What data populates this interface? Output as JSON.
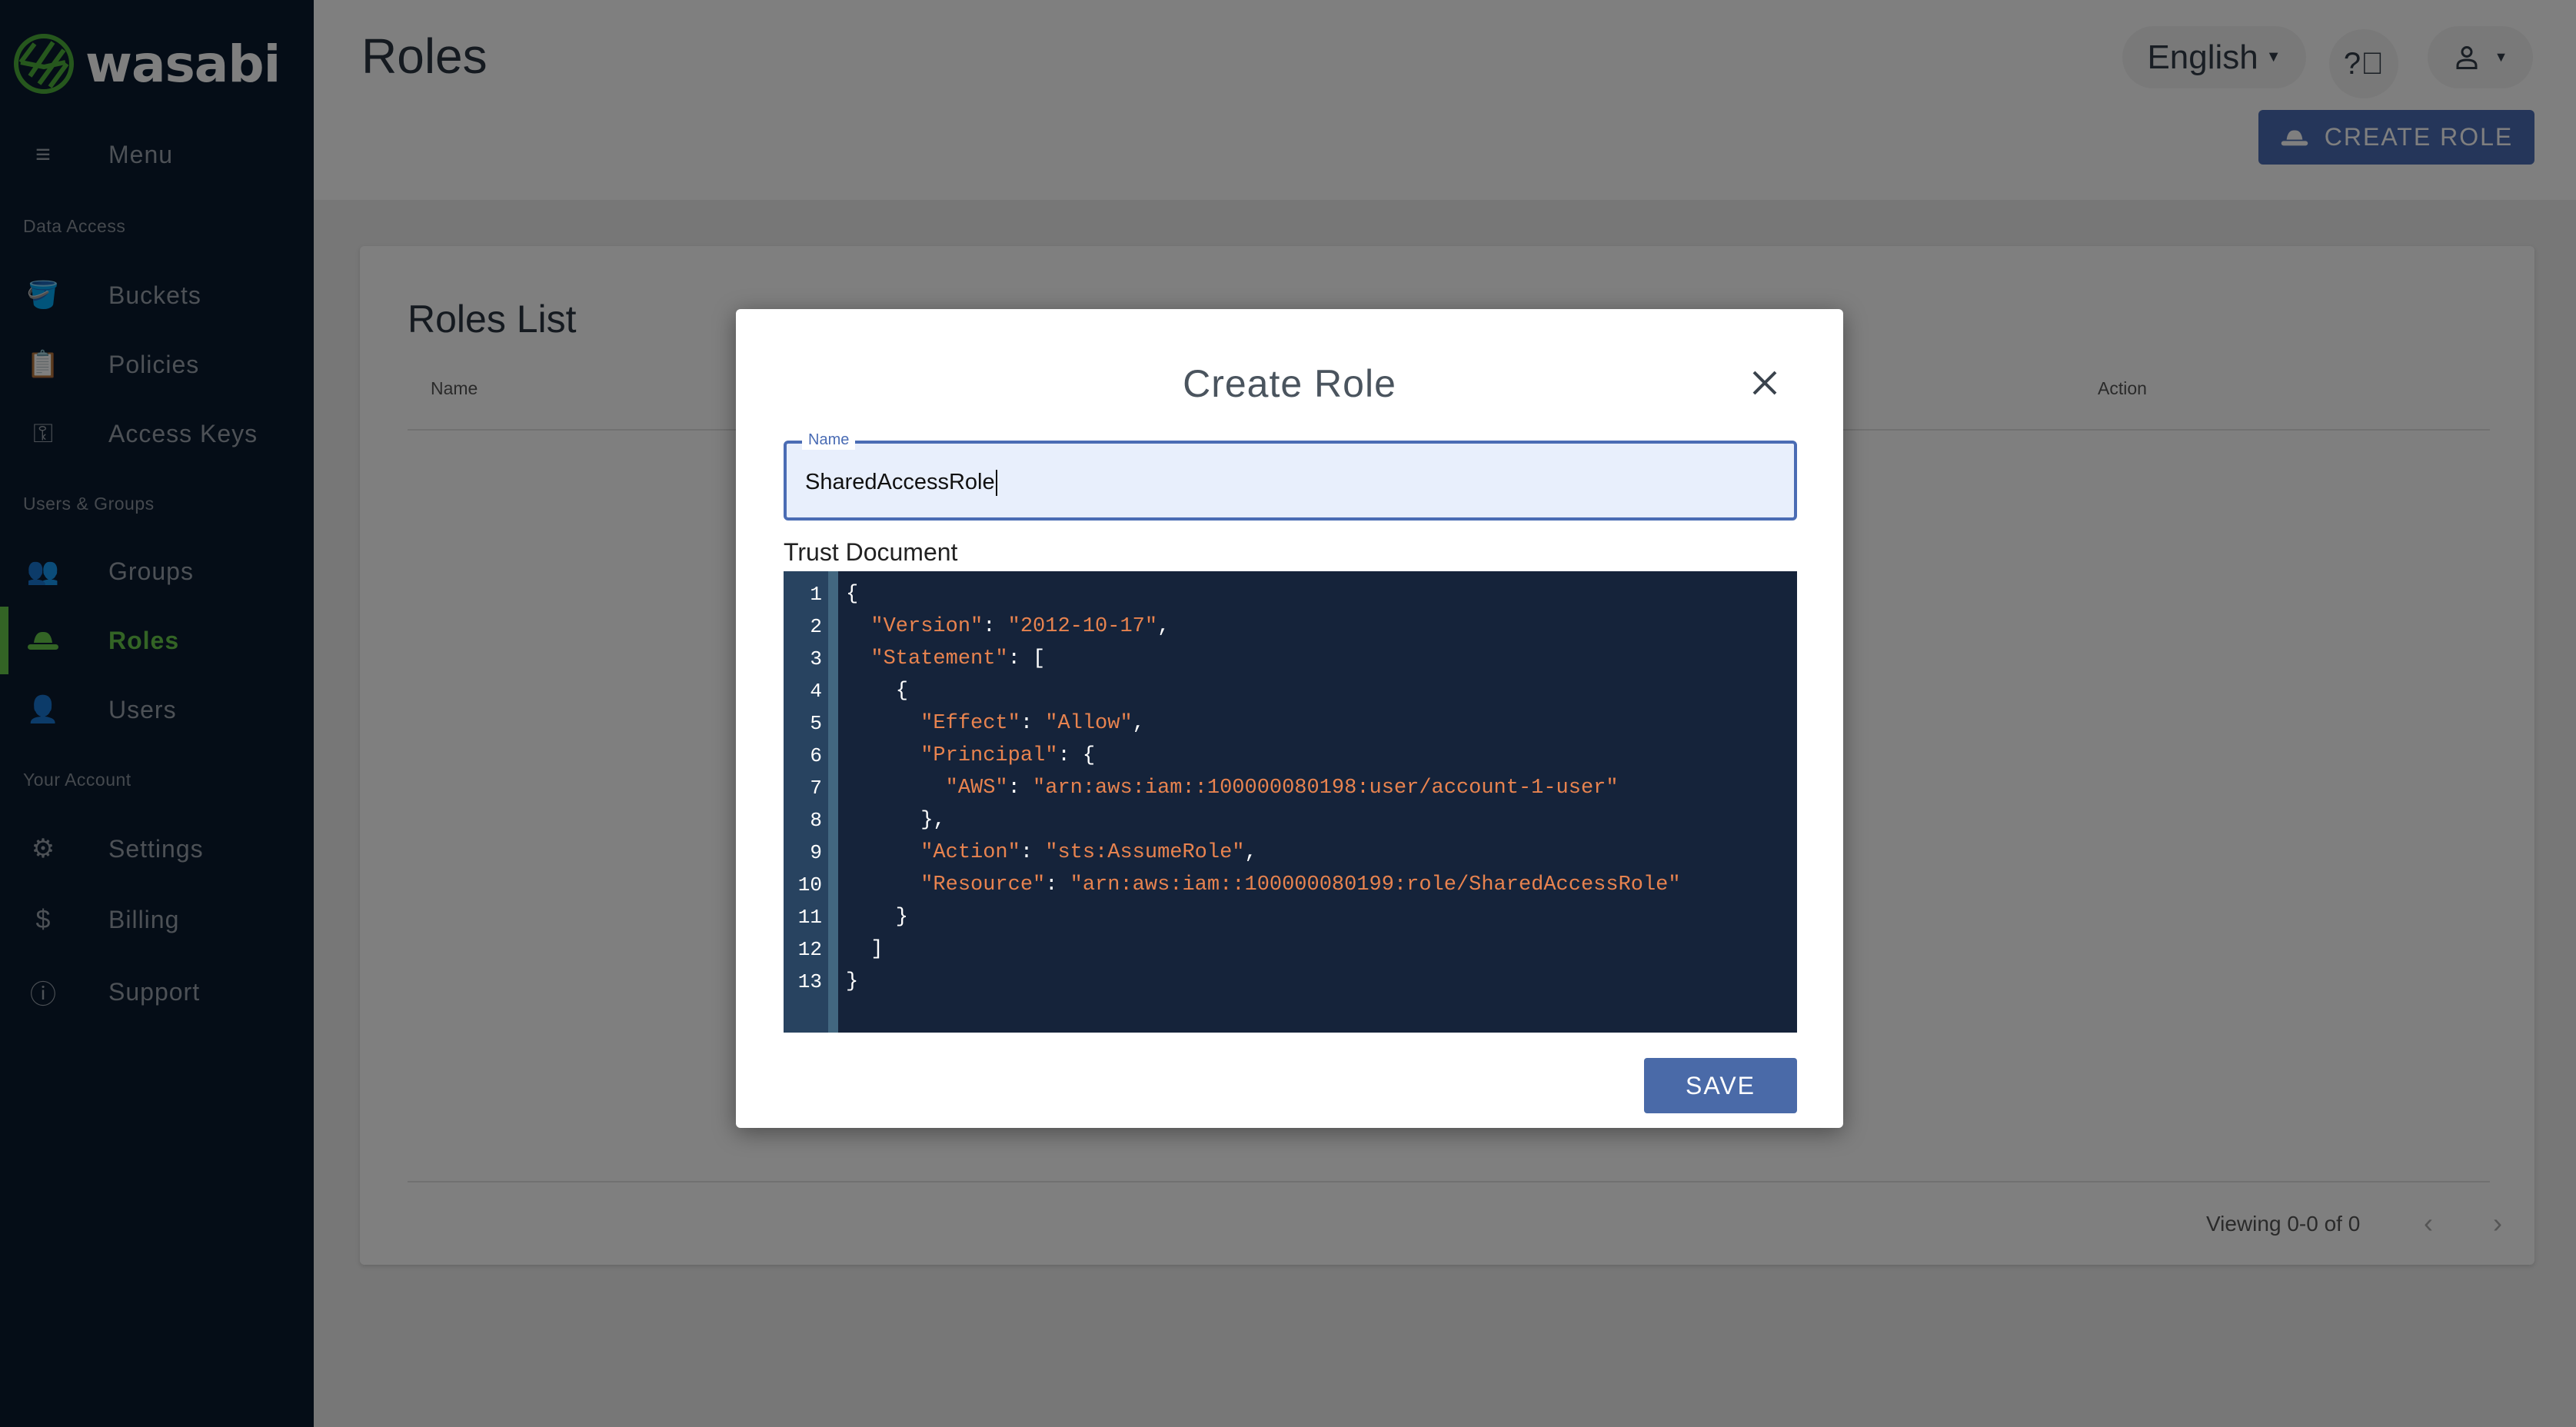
{
  "brand": {
    "name": "wasabi",
    "accent": "#66c84a"
  },
  "sidebar": {
    "menu_label": "Menu",
    "sections": [
      "Data Access",
      "Users & Groups",
      "Your Account"
    ],
    "items": [
      {
        "label": "Buckets",
        "icon": "bucket-icon"
      },
      {
        "label": "Policies",
        "icon": "clipboard-icon"
      },
      {
        "label": "Access Keys",
        "icon": "key-icon"
      },
      {
        "label": "Groups",
        "icon": "groups-icon"
      },
      {
        "label": "Roles",
        "icon": "hat-icon",
        "active": true
      },
      {
        "label": "Users",
        "icon": "users-icon"
      },
      {
        "label": "Settings",
        "icon": "gear-icon"
      },
      {
        "label": "Billing",
        "icon": "dollar-icon"
      },
      {
        "label": "Support",
        "icon": "help-circle-icon"
      }
    ]
  },
  "header": {
    "title": "Roles",
    "language": "English",
    "create_role_label": "CREATE ROLE"
  },
  "card": {
    "title": "Roles List",
    "columns": [
      "Name",
      "Action"
    ],
    "pagination": "Viewing 0-0 of 0"
  },
  "modal": {
    "title": "Create Role",
    "name_label": "Name",
    "name_value": "SharedAccessRole",
    "trust_label": "Trust Document",
    "code_lines": [
      "{",
      "  \"Version\": \"2012-10-17\",",
      "  \"Statement\": [",
      "    {",
      "      \"Effect\": \"Allow\",",
      "      \"Principal\": {",
      "        \"AWS\": \"arn:aws:iam::100000080198:user/account-1-user\"",
      "      },",
      "      \"Action\": \"sts:AssumeRole\",",
      "      \"Resource\": \"arn:aws:iam::100000080199:role/SharedAccessRole\"",
      "    }",
      "  ]",
      "}"
    ],
    "save_label": "SAVE"
  }
}
